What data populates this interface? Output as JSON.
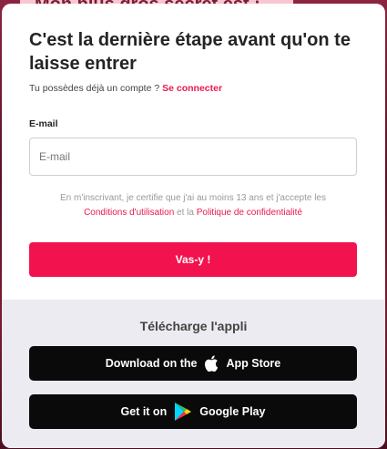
{
  "backdrop": {
    "text": "Mon plus gros secret est :"
  },
  "modal": {
    "title": "C'est la dernière étape avant qu'on te laisse entrer",
    "login_prompt": "Tu possèdes déjà un compte ?",
    "login_link": "Se connecter",
    "email_label": "E-mail",
    "email_placeholder": "E-mail",
    "email_value": "",
    "terms_prefix": "En m'inscrivant, je certifie que j'ai au moins 13 ans et j'accepte les",
    "terms_link": "Conditions d'utilisation",
    "terms_and": "et la",
    "privacy_link": "Politique de confidentialité",
    "submit_label": "Vas-y !"
  },
  "footer": {
    "title": "Télécharge l'appli",
    "appstore": {
      "prefix": "Download on the",
      "name": "App Store",
      "icon": "apple-icon"
    },
    "gplay": {
      "prefix": "Get it on",
      "name": "Google Play",
      "icon": "google-play-icon"
    }
  },
  "colors": {
    "accent": "#f2134e",
    "link": "#e8194f",
    "footer_bg": "#ebebf1",
    "store_bg": "#0a0a0a"
  }
}
